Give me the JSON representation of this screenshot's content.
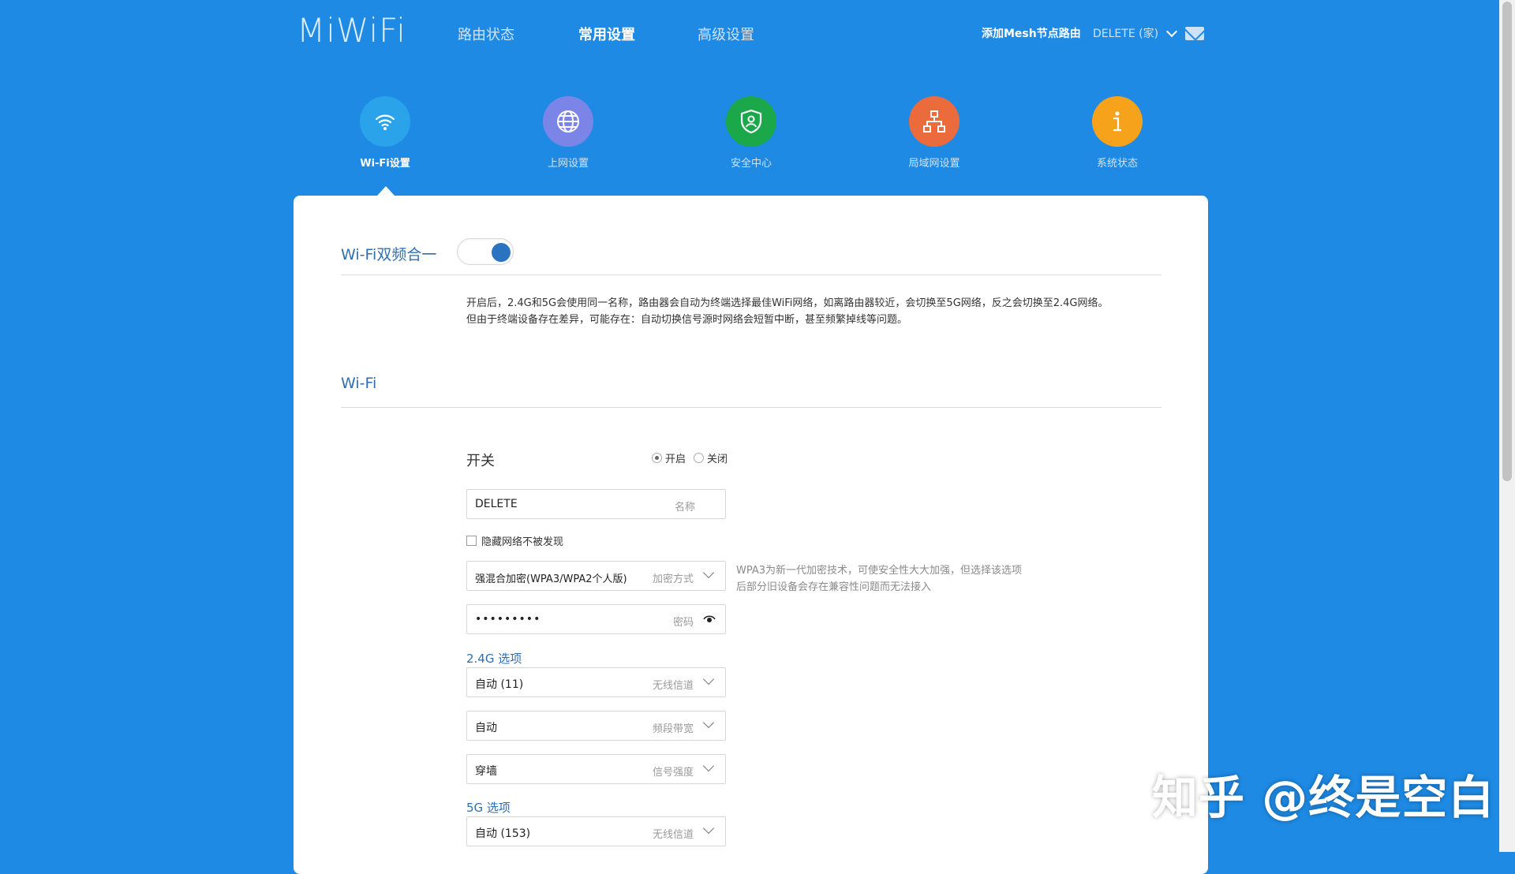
{
  "header": {
    "logo": "MiWiFi",
    "nav": [
      "路由状态",
      "常用设置",
      "高级设置"
    ],
    "add_mesh": "添加Mesh节点路由",
    "device": "DELETE (家)"
  },
  "icon_nav": [
    {
      "label": "Wi-Fi设置",
      "icon": "wifi-icon",
      "color": "#2aa3ea",
      "active": true
    },
    {
      "label": "上网设置",
      "icon": "globe-icon",
      "color": "#7b85e8",
      "active": false
    },
    {
      "label": "安全中心",
      "icon": "shield-icon",
      "color": "#1ba84b",
      "active": false
    },
    {
      "label": "局域网设置",
      "icon": "network-icon",
      "color": "#ec6b3d",
      "active": false
    },
    {
      "label": "系统状态",
      "icon": "info-icon",
      "color": "#f6a31b",
      "active": false
    }
  ],
  "dual_band": {
    "title": "Wi-Fi双频合一",
    "enabled": true,
    "desc_line1": "开启后，2.4G和5G会使用同一名称，路由器会自动为终端选择最佳WiFi网络，如离路由器较近，会切换至5G网络，反之会切换至2.4G网络。",
    "desc_line2": "但由于终端设备存在差异，可能存在：自动切换信号源时网络会短暂中断，甚至频繁掉线等问题。"
  },
  "wifi": {
    "title": "Wi-Fi",
    "switch_label": "开关",
    "radio_on": "开启",
    "radio_off": "关闭",
    "name_value": "DELETE",
    "name_hint": "名称",
    "hide_label": "隐藏网络不被发现",
    "enc_value": "强混合加密(WPA3/WPA2个人版)",
    "enc_hint": "加密方式",
    "enc_note1": "WPA3为新一代加密技术，可使安全性大大加强，但选择该选项",
    "enc_note2": "后部分旧设备会存在兼容性问题而无法接入",
    "password_value": "•••••••••",
    "password_hint": "密码",
    "opt24_title": "2.4G 选项",
    "channel24_value": "自动 (11)",
    "channel_hint": "无线信道",
    "bandwidth_value": "自动",
    "bandwidth_hint": "频段带宽",
    "signal_value": "穿墙",
    "signal_hint": "信号强度",
    "opt5_title": "5G 选项",
    "channel5_value": "自动 (153)"
  },
  "watermark": "知乎 @终是空白"
}
